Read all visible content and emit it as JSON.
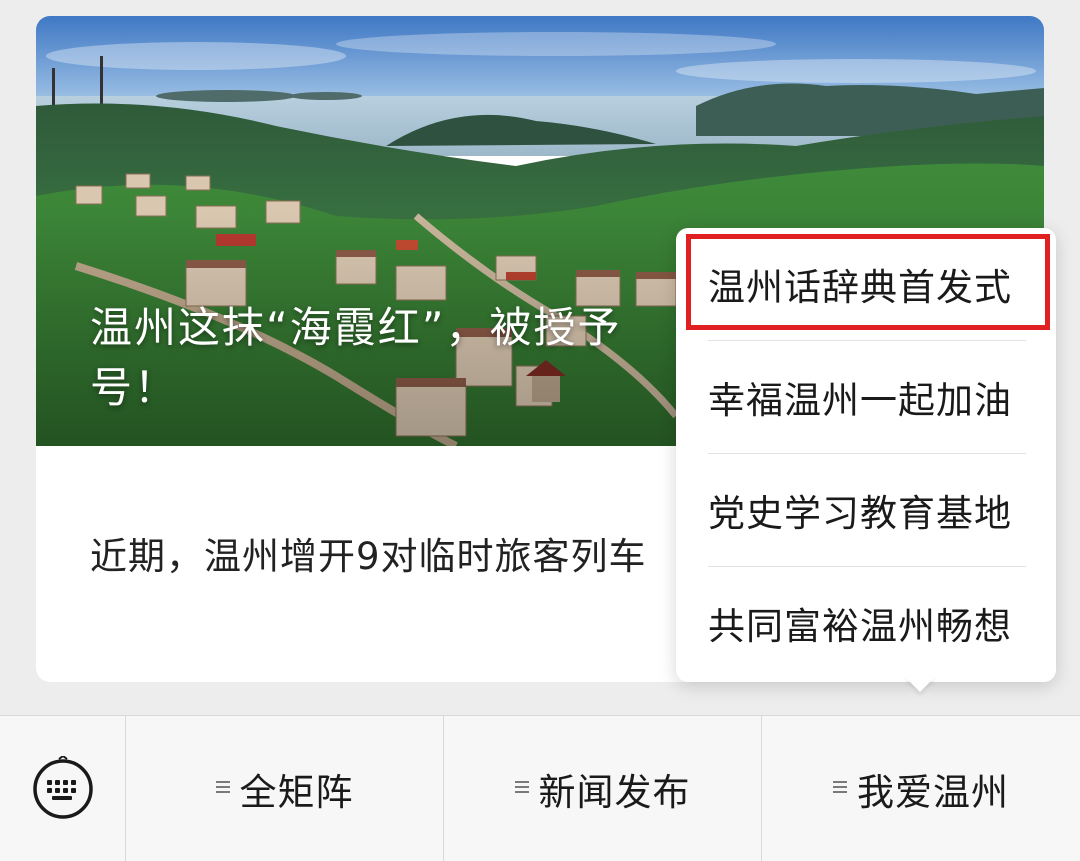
{
  "article": {
    "cover_title": "温州这抹“海霞红”，被授予…号！",
    "cover_title_line1": "温州这抹“海霞红”，被授予",
    "cover_title_line2": "号！",
    "summary": "近期，温州增开9对临时旅客列车"
  },
  "popup_menu": {
    "items": [
      {
        "label": "温州话辞典首发式",
        "highlighted": true
      },
      {
        "label": "幸福温州一起加油",
        "highlighted": false
      },
      {
        "label": "党史学习教育基地",
        "highlighted": false
      },
      {
        "label": "共同富裕温州畅想",
        "highlighted": false
      }
    ]
  },
  "bottom_menu": {
    "keyboard_icon": "keyboard-icon",
    "tabs": [
      {
        "label": "全矩阵"
      },
      {
        "label": "新闻发布"
      },
      {
        "label": "我爱温州"
      }
    ]
  },
  "colors": {
    "highlight_border": "#e02020",
    "page_background": "#ededed",
    "menu_bar_background": "#f7f7f7"
  }
}
